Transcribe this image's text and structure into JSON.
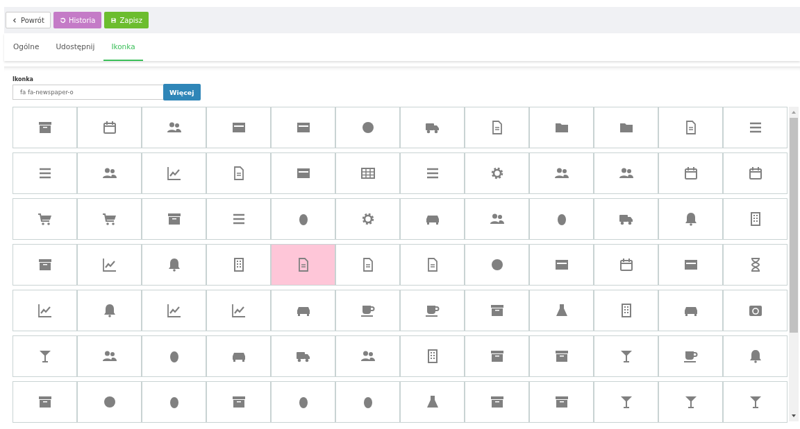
{
  "toolbar": {
    "buttons": [
      {
        "kind": "back",
        "label": "Powrót"
      },
      {
        "kind": "history",
        "label": "Historia"
      },
      {
        "kind": "save",
        "label": "Zapisz"
      }
    ]
  },
  "tabs": [
    {
      "label": "Ogólne",
      "selected": false
    },
    {
      "label": "Udostępnij",
      "selected": false
    },
    {
      "label": "Ikonka",
      "selected": true
    }
  ],
  "icon_field": {
    "label": "Ikonka",
    "value": "fa fa-newspaper-o",
    "button": "Więcej"
  },
  "icon_grid": {
    "rows": [
      [
        {
          "selected": false
        },
        {
          "selected": false
        },
        {
          "selected": false
        },
        {
          "selected": false
        },
        {
          "selected": false
        },
        {
          "selected": false
        },
        {
          "selected": false
        },
        {
          "selected": false
        },
        {
          "selected": false
        },
        {
          "selected": false
        },
        {
          "selected": false
        },
        {
          "selected": false
        }
      ],
      [
        {
          "selected": false
        },
        {
          "selected": false
        },
        {
          "selected": false
        },
        {
          "selected": false
        },
        {
          "selected": false
        },
        {
          "selected": false
        },
        {
          "selected": false
        },
        {
          "selected": false
        },
        {
          "selected": false
        },
        {
          "selected": false
        },
        {
          "selected": false
        },
        {
          "selected": false
        }
      ],
      [
        {
          "selected": false
        },
        {
          "selected": false
        },
        {
          "selected": false
        },
        {
          "selected": false
        },
        {
          "selected": false
        },
        {
          "selected": false
        },
        {
          "selected": false
        },
        {
          "selected": false
        },
        {
          "selected": false
        },
        {
          "selected": false
        },
        {
          "selected": false
        },
        {
          "selected": false
        }
      ],
      [
        {
          "selected": false
        },
        {
          "selected": false
        },
        {
          "selected": false
        },
        {
          "selected": false
        },
        {
          "selected": true
        },
        {
          "selected": false
        },
        {
          "selected": false
        },
        {
          "selected": false
        },
        {
          "selected": false
        },
        {
          "selected": false
        },
        {
          "selected": false
        },
        {
          "selected": false
        }
      ],
      [
        {
          "selected": false
        },
        {
          "selected": false
        },
        {
          "selected": false
        },
        {
          "selected": false
        },
        {
          "selected": false
        },
        {
          "selected": false
        },
        {
          "selected": false
        },
        {
          "selected": false
        },
        {
          "selected": false
        },
        {
          "selected": false
        },
        {
          "selected": false
        },
        {
          "selected": false
        }
      ],
      [
        {
          "selected": false
        },
        {
          "selected": false
        },
        {
          "selected": false
        },
        {
          "selected": false
        },
        {
          "selected": false
        },
        {
          "selected": false
        },
        {
          "selected": false
        },
        {
          "selected": false
        },
        {
          "selected": false
        },
        {
          "selected": false
        },
        {
          "selected": false
        },
        {
          "selected": false
        }
      ],
      [
        {
          "selected": false
        },
        {
          "selected": false
        },
        {
          "selected": false
        },
        {
          "selected": false
        },
        {
          "selected": false
        },
        {
          "selected": false
        },
        {
          "selected": false
        },
        {
          "selected": false
        },
        {
          "selected": false
        },
        {
          "selected": false
        },
        {
          "selected": false
        },
        {
          "selected": false
        }
      ]
    ]
  }
}
